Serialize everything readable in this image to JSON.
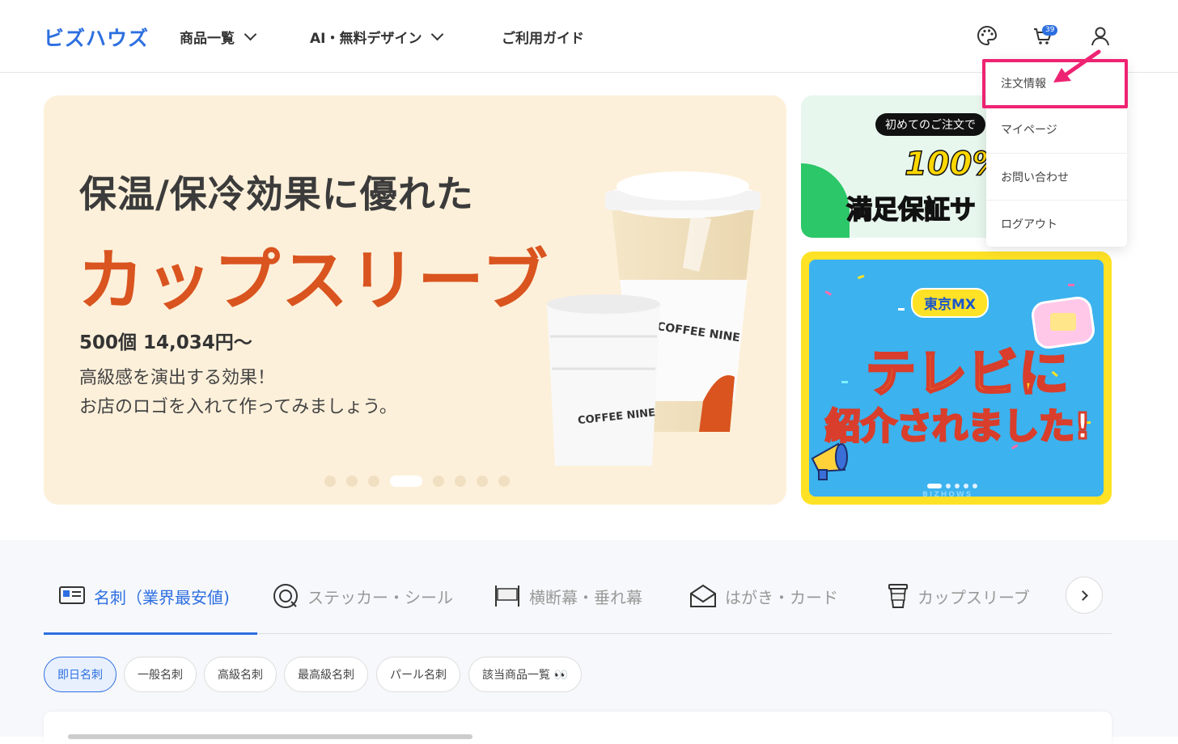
{
  "header": {
    "logo": "ビズハウズ",
    "nav": [
      {
        "label": "商品一覧",
        "has_dropdown": true
      },
      {
        "label": "AI・無料デザイン",
        "has_dropdown": true
      },
      {
        "label": "ご利用ガイド",
        "has_dropdown": false
      }
    ],
    "icons": [
      "palette-icon",
      "cart-icon",
      "user-icon"
    ],
    "cart_count": "39"
  },
  "user_menu": {
    "items": [
      "注文情報",
      "マイページ",
      "お問い合わせ",
      "ログアウト"
    ],
    "highlighted": "注文情報"
  },
  "hero": {
    "title": "保温/保冷効果に優れた",
    "headline": "カップスリーブ",
    "price": "500個 14,034円〜",
    "desc1": "高級感を演出する効果！",
    "desc2": "お店のロゴを入れて作ってみましょう。",
    "slide_count": 8,
    "active_slide": 4,
    "product_text": "COFFEE NINE"
  },
  "banner1": {
    "pill": "初めてのご注文で",
    "big": "100%",
    "text": "満足保証サ"
  },
  "banner2": {
    "pill": "東京MX",
    "line1": "テレビに",
    "line2": "紹介されました!",
    "footer": "BIZHOWS"
  },
  "category_tabs": [
    {
      "label": "名刺（業界最安値)",
      "icon": "business-card-icon",
      "active": true
    },
    {
      "label": "ステッカー・シール",
      "icon": "sticker-icon",
      "active": false
    },
    {
      "label": "横断幕・垂れ幕",
      "icon": "banner-icon",
      "active": false
    },
    {
      "label": "はがき・カード",
      "icon": "envelope-icon",
      "active": false
    },
    {
      "label": "カップスリーブ",
      "icon": "cup-icon",
      "active": false
    }
  ],
  "chips": [
    {
      "label": "即日名刺",
      "active": true
    },
    {
      "label": "一般名刺",
      "active": false
    },
    {
      "label": "高級名刺",
      "active": false
    },
    {
      "label": "最高級名刺",
      "active": false
    },
    {
      "label": "パール名刺",
      "active": false
    },
    {
      "label": "該当商品一覧 👀",
      "active": false
    }
  ],
  "colors": {
    "brand": "#2d6fe0",
    "accent": "#d9541f",
    "highlight": "#ee2372"
  }
}
